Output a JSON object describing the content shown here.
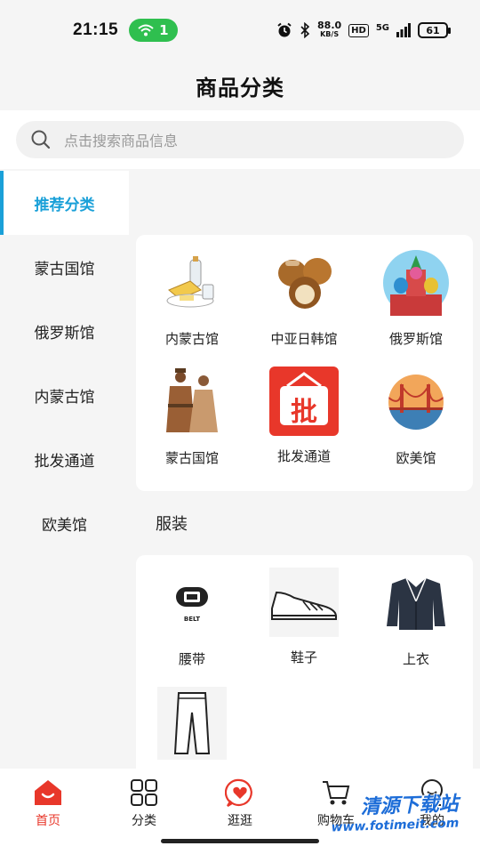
{
  "status_bar": {
    "time": "21:15",
    "hotspot_count": "1",
    "net_speed_value": "88.0",
    "net_speed_unit": "KB/S",
    "hd_label": "HD",
    "signal_label": "5G",
    "battery": "61"
  },
  "header": {
    "title": "商品分类"
  },
  "search": {
    "placeholder": "点击搜索商品信息"
  },
  "sidebar": {
    "items": [
      {
        "label": "推荐分类",
        "active": true
      },
      {
        "label": "蒙古国馆"
      },
      {
        "label": "俄罗斯馆"
      },
      {
        "label": "内蒙古馆"
      },
      {
        "label": "批发通道"
      },
      {
        "label": "欧美馆"
      }
    ]
  },
  "recommend": {
    "items": [
      {
        "label": "内蒙古馆",
        "icon": "dairy-icon"
      },
      {
        "label": "中亚日韩馆",
        "icon": "hazelnut-icon"
      },
      {
        "label": "俄罗斯馆",
        "icon": "kremlin-icon"
      },
      {
        "label": "蒙古国馆",
        "icon": "mongolian-people-icon"
      },
      {
        "label": "批发通道",
        "icon": "wholesale-basket-icon",
        "badge": "批"
      },
      {
        "label": "欧美馆",
        "icon": "golden-gate-icon"
      }
    ]
  },
  "clothes": {
    "title": "服装",
    "items": [
      {
        "label": "腰带",
        "icon": "belt-icon",
        "caption": "BELT"
      },
      {
        "label": "鞋子",
        "icon": "shoe-icon"
      },
      {
        "label": "上衣",
        "icon": "jacket-icon"
      },
      {
        "label": "",
        "icon": "pants-icon"
      }
    ]
  },
  "tab_bar": {
    "tabs": [
      {
        "label": "首页",
        "active": true
      },
      {
        "label": "分类"
      },
      {
        "label": "逛逛"
      },
      {
        "label": "购物车"
      },
      {
        "label": "我的"
      }
    ]
  },
  "watermark": {
    "text": "清源下载站",
    "url": "www.fotimeit.com"
  },
  "colors": {
    "accent": "#1aa0d8",
    "brand_red": "#e8372a",
    "hotspot_green": "#2fbf4f"
  }
}
